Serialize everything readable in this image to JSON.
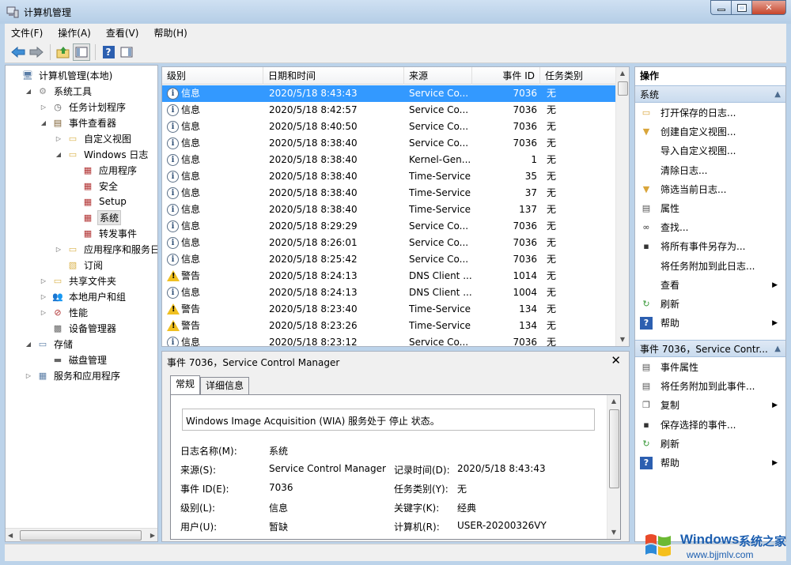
{
  "window": {
    "title": "计算机管理"
  },
  "menu": [
    "文件(F)",
    "操作(A)",
    "查看(V)",
    "帮助(H)"
  ],
  "tree": [
    {
      "label": "计算机管理(本地)",
      "level": 0,
      "exp": "",
      "icon": "computer-icon",
      "selected": false
    },
    {
      "label": "系统工具",
      "level": 1,
      "exp": "open",
      "icon": "tools-icon",
      "selected": false
    },
    {
      "label": "任务计划程序",
      "level": 2,
      "exp": "closed",
      "icon": "clock-icon",
      "selected": false
    },
    {
      "label": "事件查看器",
      "level": 2,
      "exp": "open",
      "icon": "event-viewer-icon",
      "selected": false
    },
    {
      "label": "自定义视图",
      "level": 3,
      "exp": "closed",
      "icon": "folder-icon",
      "selected": false
    },
    {
      "label": "Windows 日志",
      "level": 3,
      "exp": "open",
      "icon": "folder-icon",
      "selected": false
    },
    {
      "label": "应用程序",
      "level": 4,
      "exp": "",
      "icon": "log-icon",
      "selected": false
    },
    {
      "label": "安全",
      "level": 4,
      "exp": "",
      "icon": "log-icon",
      "selected": false
    },
    {
      "label": "Setup",
      "level": 4,
      "exp": "",
      "icon": "log-icon",
      "selected": false
    },
    {
      "label": "系统",
      "level": 4,
      "exp": "",
      "icon": "log-icon",
      "selected": true
    },
    {
      "label": "转发事件",
      "level": 4,
      "exp": "",
      "icon": "log-icon",
      "selected": false
    },
    {
      "label": "应用程序和服务日志",
      "level": 3,
      "exp": "closed",
      "icon": "folder-icon",
      "selected": false
    },
    {
      "label": "订阅",
      "level": 3,
      "exp": "",
      "icon": "subscription-icon",
      "selected": false
    },
    {
      "label": "共享文件夹",
      "level": 2,
      "exp": "closed",
      "icon": "shared-folder-icon",
      "selected": false
    },
    {
      "label": "本地用户和组",
      "level": 2,
      "exp": "closed",
      "icon": "users-icon",
      "selected": false
    },
    {
      "label": "性能",
      "level": 2,
      "exp": "closed",
      "icon": "performance-icon",
      "selected": false
    },
    {
      "label": "设备管理器",
      "level": 2,
      "exp": "",
      "icon": "device-manager-icon",
      "selected": false
    },
    {
      "label": "存储",
      "level": 1,
      "exp": "open",
      "icon": "storage-icon",
      "selected": false
    },
    {
      "label": "磁盘管理",
      "level": 2,
      "exp": "",
      "icon": "disk-icon",
      "selected": false
    },
    {
      "label": "服务和应用程序",
      "level": 1,
      "exp": "closed",
      "icon": "services-icon",
      "selected": false
    }
  ],
  "events": {
    "columns": [
      "级别",
      "日期和时间",
      "来源",
      "事件 ID",
      "任务类别"
    ],
    "rows": [
      {
        "level": "信息",
        "type": "info",
        "datetime": "2020/5/18 8:43:43",
        "source": "Service Co...",
        "id": "7036",
        "category": "无",
        "selected": true
      },
      {
        "level": "信息",
        "type": "info",
        "datetime": "2020/5/18 8:42:57",
        "source": "Service Co...",
        "id": "7036",
        "category": "无",
        "selected": false
      },
      {
        "level": "信息",
        "type": "info",
        "datetime": "2020/5/18 8:40:50",
        "source": "Service Co...",
        "id": "7036",
        "category": "无",
        "selected": false
      },
      {
        "level": "信息",
        "type": "info",
        "datetime": "2020/5/18 8:38:40",
        "source": "Service Co...",
        "id": "7036",
        "category": "无",
        "selected": false
      },
      {
        "level": "信息",
        "type": "info",
        "datetime": "2020/5/18 8:38:40",
        "source": "Kernel-Gen...",
        "id": "1",
        "category": "无",
        "selected": false
      },
      {
        "level": "信息",
        "type": "info",
        "datetime": "2020/5/18 8:38:40",
        "source": "Time-Service",
        "id": "35",
        "category": "无",
        "selected": false
      },
      {
        "level": "信息",
        "type": "info",
        "datetime": "2020/5/18 8:38:40",
        "source": "Time-Service",
        "id": "37",
        "category": "无",
        "selected": false
      },
      {
        "level": "信息",
        "type": "info",
        "datetime": "2020/5/18 8:38:40",
        "source": "Time-Service",
        "id": "137",
        "category": "无",
        "selected": false
      },
      {
        "level": "信息",
        "type": "info",
        "datetime": "2020/5/18 8:29:29",
        "source": "Service Co...",
        "id": "7036",
        "category": "无",
        "selected": false
      },
      {
        "level": "信息",
        "type": "info",
        "datetime": "2020/5/18 8:26:01",
        "source": "Service Co...",
        "id": "7036",
        "category": "无",
        "selected": false
      },
      {
        "level": "信息",
        "type": "info",
        "datetime": "2020/5/18 8:25:42",
        "source": "Service Co...",
        "id": "7036",
        "category": "无",
        "selected": false
      },
      {
        "level": "警告",
        "type": "warn",
        "datetime": "2020/5/18 8:24:13",
        "source": "DNS Client ...",
        "id": "1014",
        "category": "无",
        "selected": false
      },
      {
        "level": "信息",
        "type": "info",
        "datetime": "2020/5/18 8:24:13",
        "source": "DNS Client ...",
        "id": "1004",
        "category": "无",
        "selected": false
      },
      {
        "level": "警告",
        "type": "warn",
        "datetime": "2020/5/18 8:23:40",
        "source": "Time-Service",
        "id": "134",
        "category": "无",
        "selected": false
      },
      {
        "level": "警告",
        "type": "warn",
        "datetime": "2020/5/18 8:23:26",
        "source": "Time-Service",
        "id": "134",
        "category": "无",
        "selected": false
      },
      {
        "level": "信息",
        "type": "info",
        "datetime": "2020/5/18 8:23:12",
        "source": "Service Co...",
        "id": "7036",
        "category": "无",
        "selected": false
      }
    ]
  },
  "detail": {
    "title": "事件 7036，Service Control Manager",
    "tabs": [
      "常规",
      "详细信息"
    ],
    "description": "Windows Image Acquisition (WIA) 服务处于 停止 状态。",
    "fields": {
      "log_name_label": "日志名称(M):",
      "log_name": "系统",
      "source_label": "来源(S):",
      "source": "Service Control Manager",
      "logged_label": "记录时间(D):",
      "logged": "2020/5/18 8:43:43",
      "event_id_label": "事件 ID(E):",
      "event_id": "7036",
      "task_label": "任务类别(Y):",
      "task": "无",
      "level_label": "级别(L):",
      "level": "信息",
      "keywords_label": "关键字(K):",
      "keywords": "经典",
      "user_label": "用户(U):",
      "user": "暂缺",
      "computer_label": "计算机(R):",
      "computer": "USER-20200326VY"
    }
  },
  "actions": {
    "header": "操作",
    "section1": "系统",
    "items1": [
      {
        "label": "打开保存的日志...",
        "icon": "open-folder-icon",
        "sub": false
      },
      {
        "label": "创建自定义视图...",
        "icon": "filter-icon",
        "sub": false
      },
      {
        "label": "导入自定义视图...",
        "icon": "",
        "sub": false
      },
      {
        "label": "清除日志...",
        "icon": "",
        "sub": false
      },
      {
        "label": "筛选当前日志...",
        "icon": "filter-icon",
        "sub": false
      },
      {
        "label": "属性",
        "icon": "properties-icon",
        "sub": false
      },
      {
        "label": "查找...",
        "icon": "binoculars-icon",
        "sub": false
      },
      {
        "label": "将所有事件另存为...",
        "icon": "save-icon",
        "sub": false
      },
      {
        "label": "将任务附加到此日志...",
        "icon": "",
        "sub": false
      },
      {
        "label": "查看",
        "icon": "",
        "sub": true
      },
      {
        "label": "刷新",
        "icon": "refresh-icon",
        "sub": false
      },
      {
        "label": "帮助",
        "icon": "help-icon",
        "sub": true
      }
    ],
    "section2": "事件 7036，Service Contr...",
    "items2": [
      {
        "label": "事件属性",
        "icon": "properties-icon",
        "sub": false
      },
      {
        "label": "将任务附加到此事件...",
        "icon": "task-icon",
        "sub": false
      },
      {
        "label": "复制",
        "icon": "copy-icon",
        "sub": true
      },
      {
        "label": "保存选择的事件...",
        "icon": "save-icon",
        "sub": false
      },
      {
        "label": "刷新",
        "icon": "refresh-icon",
        "sub": false
      },
      {
        "label": "帮助",
        "icon": "help-icon",
        "sub": true
      }
    ]
  },
  "watermark": {
    "brand": "Windows",
    "brand2": "系统之家",
    "url": "www.bjjmlv.com"
  }
}
